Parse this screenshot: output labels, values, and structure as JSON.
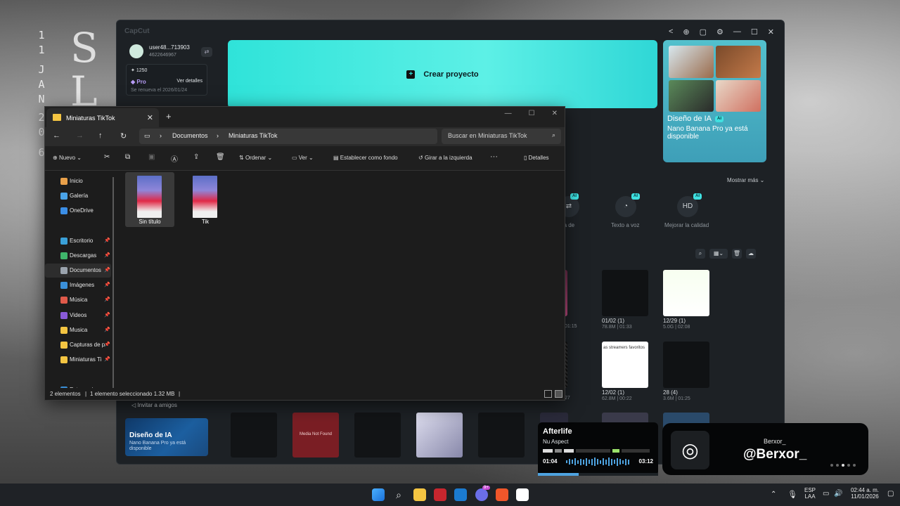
{
  "desktop": {
    "clock_digits": [
      "1",
      "1",
      "J",
      "A",
      "N",
      "2",
      "0",
      "6"
    ],
    "big_letters": [
      "S",
      "L"
    ]
  },
  "capcut": {
    "app_title": "CapCut",
    "user": {
      "name": "user48...713903",
      "id": "4622646967"
    },
    "credits": "1250",
    "pro": {
      "label": "Pro",
      "details": "Ver detalles",
      "renew": "Se renueva el 2026/01/24"
    },
    "create_project": "Crear proyecto",
    "promo": {
      "title": "Diseño de IA",
      "desc": "Nano Banana Pro ya está disponible",
      "badge": "AI"
    },
    "show_more": "Mostrar más",
    "tools": [
      {
        "label": "ropa de",
        "badge": "AI"
      },
      {
        "label": "Texto a voz",
        "badge": "AI"
      },
      {
        "label": "Mejorar la calidad",
        "badge": "AI"
      }
    ],
    "projects_row1": [
      {
        "date": "",
        "meta": "01:15"
      },
      {
        "date": "01/02 (1)",
        "meta": "78.8M | 01:33"
      },
      {
        "date": "12/29 (1)",
        "meta": "5.0G | 02:08"
      }
    ],
    "projects_row2": [
      {
        "date": "",
        "meta": "27"
      },
      {
        "date": "12/02 (1)",
        "meta": "62.8M | 00:22"
      },
      {
        "date": "28 (4)",
        "meta": "3.6M | 01:25"
      }
    ],
    "invite": "Invitar a amigos",
    "side_promo": {
      "title": "Diseño de IA",
      "desc": "Nano Banana Pro ya está disponible"
    },
    "media_not_found": "Media Not Found",
    "thumb_promo_text": "as streamers favoritos"
  },
  "music": {
    "title": "Afterlife",
    "artist": "Nu Aspect",
    "elapsed": "01:04",
    "total": "03:12",
    "progress": 0.34
  },
  "instagram": {
    "handle_small": "Berxor_",
    "handle_big": "@Berxor_"
  },
  "explorer": {
    "tab_title": "Miniaturas TikTok",
    "breadcrumb": [
      "Documentos",
      "Miniaturas TikTok"
    ],
    "search_placeholder": "Buscar en Miniaturas TikTok",
    "commands": {
      "new": "Nuevo",
      "sort": "Ordenar",
      "view": "Ver",
      "set_bg": "Establecer como fondo",
      "rotate": "Girar a la izquierda",
      "details": "Detalles"
    },
    "nav": [
      {
        "label": "Inicio",
        "icon": "home-icon",
        "color": "#e8a04a",
        "pin": false
      },
      {
        "label": "Galería",
        "icon": "gallery-icon",
        "color": "#4aa3e8",
        "pin": false
      },
      {
        "label": "OneDrive",
        "icon": "cloud-icon",
        "color": "#3b8ee6",
        "pin": false
      },
      {
        "label": "Escritorio",
        "icon": "desktop-icon",
        "color": "#3aa0d8",
        "pin": true
      },
      {
        "label": "Descargas",
        "icon": "download-icon",
        "color": "#3fb56b",
        "pin": true
      },
      {
        "label": "Documentos",
        "icon": "document-icon",
        "color": "#9aa3ad",
        "pin": true
      },
      {
        "label": "Imágenes",
        "icon": "image-icon",
        "color": "#3a8fd8",
        "pin": true
      },
      {
        "label": "Música",
        "icon": "music-icon",
        "color": "#e05a4a",
        "pin": true
      },
      {
        "label": "Videos",
        "icon": "video-icon",
        "color": "#8a5ad8",
        "pin": true
      },
      {
        "label": "Musica",
        "icon": "folder-icon",
        "color": "#f4c542",
        "pin": true
      },
      {
        "label": "Capturas de p",
        "icon": "folder-icon",
        "color": "#f4c542",
        "pin": true
      },
      {
        "label": "Miniaturas Ti",
        "icon": "folder-icon",
        "color": "#f4c542",
        "pin": true
      },
      {
        "label": "Este equipo",
        "icon": "pc-icon",
        "color": "#3a8fd8",
        "pin": false
      }
    ],
    "files": [
      {
        "name": "Sin título",
        "selected": true
      },
      {
        "name": "Tik",
        "selected": false
      }
    ],
    "status": {
      "count": "2 elementos",
      "selection": "1 elemento seleccionado  1.32 MB"
    }
  },
  "taskbar": {
    "lang1": "ESP",
    "lang2": "LAA",
    "time": "02:44 a. m.",
    "date": "11/01/2026",
    "discord_badge": "9+"
  }
}
